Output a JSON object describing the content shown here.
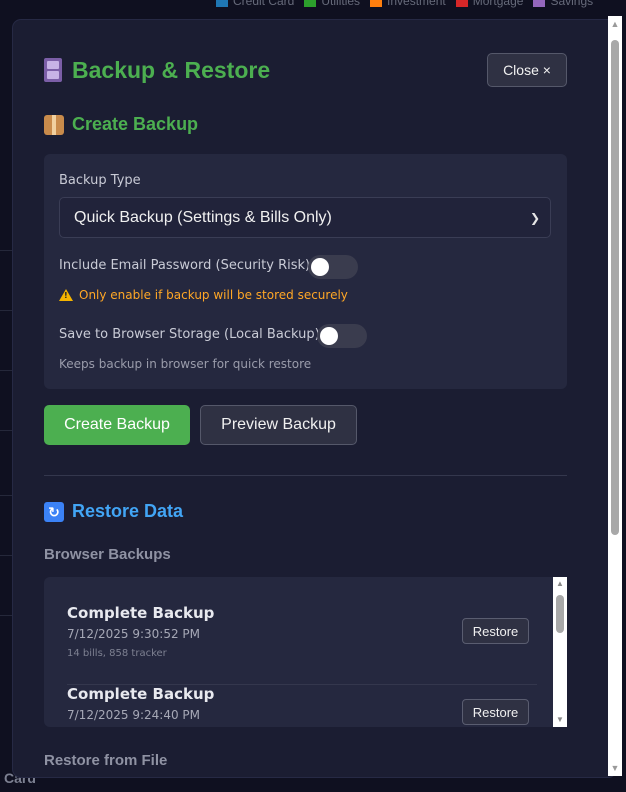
{
  "background": {
    "legend": [
      {
        "label": "Credit Card",
        "color": "#1f77b4"
      },
      {
        "label": "Utilities",
        "color": "#2ca02c"
      },
      {
        "label": "Investment",
        "color": "#ff7f0e"
      },
      {
        "label": "Mortgage",
        "color": "#d62728"
      },
      {
        "label": "Savings",
        "color": "#9467bd"
      }
    ],
    "bottom_text": "Card"
  },
  "modal": {
    "title": "Backup & Restore",
    "close_label": "Close ×",
    "create": {
      "heading": "Create Backup",
      "backup_type_label": "Backup Type",
      "backup_type_value": "Quick Backup (Settings & Bills Only)",
      "include_email_label": "Include Email Password (Security Risk)",
      "include_email_on": false,
      "warning": "Only enable if backup will be stored securely",
      "save_browser_label": "Save to Browser Storage (Local Backup)",
      "save_browser_on": false,
      "save_browser_help": "Keeps backup in browser for quick restore",
      "create_button": "Create Backup",
      "preview_button": "Preview Backup"
    },
    "restore": {
      "heading": "Restore Data",
      "browser_backups_label": "Browser Backups",
      "backups": [
        {
          "name": "Complete Backup",
          "date": "7/12/2025 9:30:52 PM",
          "meta": "14 bills, 858 tracker",
          "action": "Restore"
        },
        {
          "name": "Complete Backup",
          "date": "7/12/2025 9:24:40 PM",
          "meta": "",
          "action": "Restore"
        }
      ],
      "restore_from_file_label": "Restore from File"
    }
  },
  "colors": {
    "accent_green": "#4caf50",
    "accent_blue": "#42a5f5",
    "warning": "#ffa726",
    "modal_bg": "#1b1d32"
  }
}
